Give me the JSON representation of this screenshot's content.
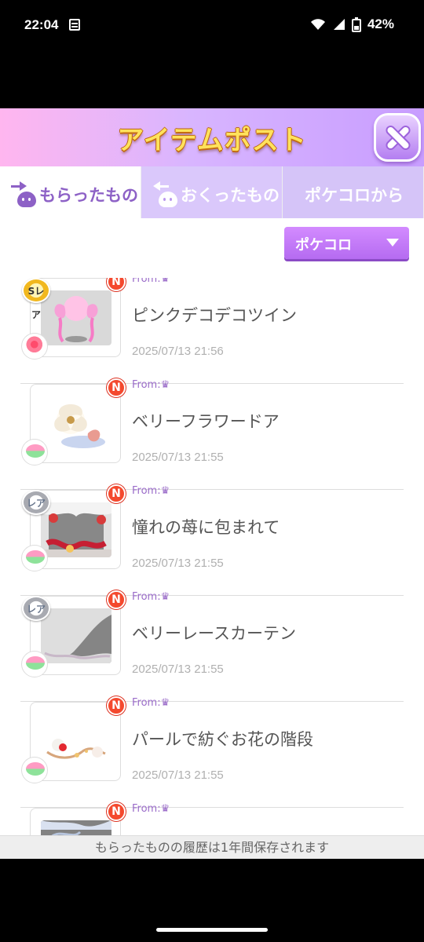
{
  "status_bar": {
    "time": "22:04",
    "battery": "42%",
    "icons": [
      "note-icon",
      "wifi-icon",
      "signal-icon",
      "battery-icon"
    ]
  },
  "header": {
    "title": "アイテムポスト",
    "close_icon": "close-icon"
  },
  "tabs": [
    {
      "label": "もらったもの",
      "active": true
    },
    {
      "label": "おくったもの",
      "active": false
    },
    {
      "label": "ポケコロから",
      "active": false
    }
  ],
  "filter": {
    "selected": "ポケコロ",
    "icon": "chevron-down-icon"
  },
  "items": [
    {
      "rarity": "Sレア",
      "from": "From:♛",
      "name": "ピンクデコデコツイン",
      "date": "2025/07/13 21:56",
      "new": "N"
    },
    {
      "rarity": "",
      "from": "From:♛",
      "name": "ベリーフラワードア",
      "date": "2025/07/13 21:55",
      "new": "N"
    },
    {
      "rarity": "レア",
      "from": "From:♛",
      "name": "憧れの苺に包まれて",
      "date": "2025/07/13 21:55",
      "new": "N"
    },
    {
      "rarity": "レア",
      "from": "From:♛",
      "name": "ベリーレースカーテン",
      "date": "2025/07/13 21:55",
      "new": "N"
    },
    {
      "rarity": "",
      "from": "From:♛",
      "name": "パールで紡ぐお花の階段",
      "date": "2025/07/13 21:55",
      "new": "N"
    },
    {
      "rarity": "",
      "from": "From:♛",
      "name": "",
      "date": "",
      "new": "N"
    }
  ],
  "footer": {
    "note": "もらったものの履歴は1年間保存されます"
  },
  "colors": {
    "header_gradient": "#ffb6ef",
    "accent_purple": "#8d61c6",
    "dropdown_purple": "#c77df9",
    "new_badge": "#f4492e"
  }
}
